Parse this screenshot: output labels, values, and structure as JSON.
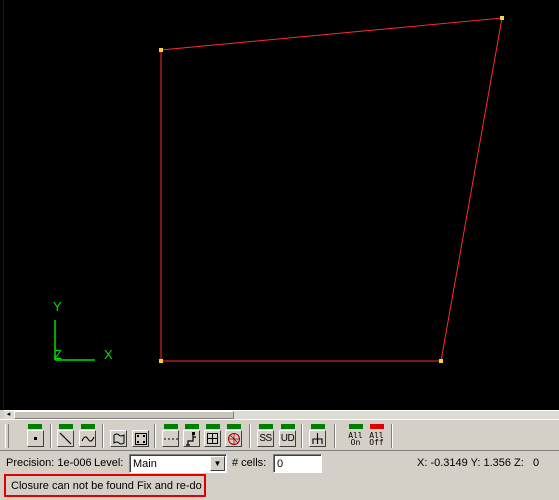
{
  "scene": {
    "background": "#000000",
    "polygon_color": "#ff2a2a",
    "vertex_color": "#ffd040",
    "axis_color": "#00e000",
    "axis_labels": {
      "y": "Y",
      "z": "Z",
      "x": "X"
    }
  },
  "toolbar": {
    "buttons": [
      {
        "name": "point-button",
        "icon": "point-icon",
        "label": ""
      },
      {
        "name": "line-button",
        "icon": "line-icon",
        "label": ""
      },
      {
        "name": "curve-button",
        "icon": "curve-icon",
        "label": ""
      },
      {
        "name": "surface-button",
        "icon": "surface-icon",
        "label": ""
      },
      {
        "name": "volume-button",
        "icon": "volume-icon",
        "label": ""
      },
      {
        "name": "dashed-line-button",
        "icon": "dashed-line-icon",
        "label": ""
      },
      {
        "name": "node-button",
        "icon": "node-icon",
        "label": ""
      },
      {
        "name": "grid-button",
        "icon": "grid-icon",
        "label": ""
      },
      {
        "name": "mesh-button",
        "icon": "mesh-icon",
        "label": ""
      },
      {
        "name": "ss-button",
        "icon": "",
        "label": "SS"
      },
      {
        "name": "ud-button",
        "icon": "",
        "label": "UD"
      },
      {
        "name": "branch-button",
        "icon": "branch-icon",
        "label": ""
      },
      {
        "name": "all-on-button",
        "icon": "",
        "label": "All On",
        "line1": "All",
        "line2": "On"
      },
      {
        "name": "all-off-button",
        "icon": "",
        "label": "All Off",
        "line1": "All",
        "line2": "Off"
      }
    ],
    "led_on_color": "#008000",
    "led_off_color": "#e00000"
  },
  "status": {
    "precision_label": "Precision: 1e-006",
    "level_label": "Level:",
    "level_value": "Main",
    "cells_label": "# cells:",
    "cells_value": "0",
    "coords": "X: -0.3149 Y: 1.356 Z:   0"
  },
  "message": {
    "text": "Closure can not be found Fix and re-do",
    "border_color": "#e00000"
  }
}
